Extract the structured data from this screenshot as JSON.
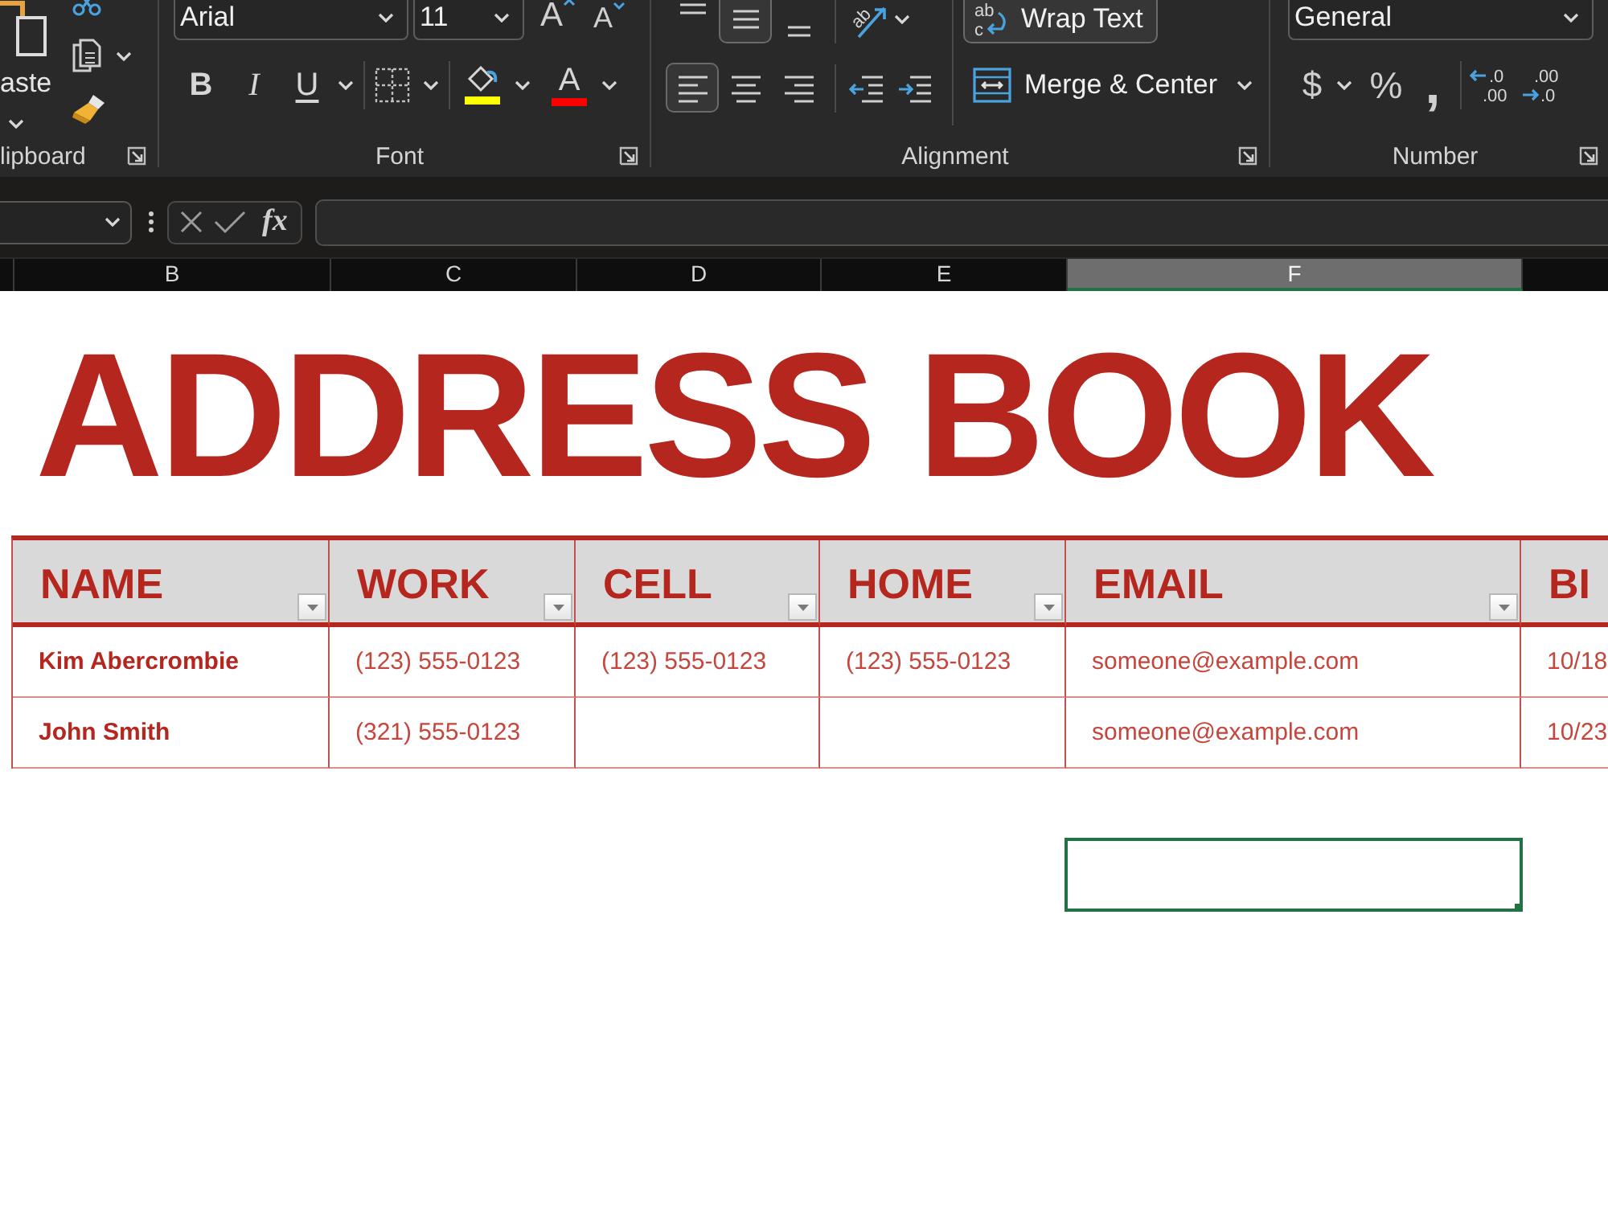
{
  "ribbon": {
    "clipboard": {
      "paste_label": "aste",
      "group_label": "lipboard"
    },
    "font": {
      "font_name": "Arial",
      "font_size": "11",
      "grow_label": "A",
      "shrink_label": "A",
      "styles": [
        {
          "kind": "bold",
          "label": "B"
        },
        {
          "kind": "italic",
          "label": "I"
        },
        {
          "kind": "underline",
          "label": "U"
        }
      ],
      "color_buttons": [
        {
          "kind": "fill",
          "color": "#ffff00"
        },
        {
          "kind": "font",
          "label": "A",
          "color": "#ff0000"
        }
      ],
      "group_label": "Font"
    },
    "alignment": {
      "vertical": [
        {
          "kind": "top",
          "selected": false
        },
        {
          "kind": "middle",
          "selected": true
        },
        {
          "kind": "bottom",
          "selected": false
        }
      ],
      "orientation_label": "ab",
      "horizontal": [
        {
          "kind": "left",
          "selected": true
        },
        {
          "kind": "center",
          "selected": false
        },
        {
          "kind": "right",
          "selected": false
        }
      ],
      "wrap_text": {
        "label": "Wrap Text",
        "icon_letters": [
          "ab",
          "c"
        ],
        "selected": true
      },
      "merge": {
        "label": "Merge & Center"
      },
      "group_label": "Alignment"
    },
    "number": {
      "format": "General",
      "symbols": [
        {
          "kind": "currency",
          "label": "$"
        },
        {
          "kind": "percent",
          "label": "%"
        },
        {
          "kind": "comma",
          "label": ","
        }
      ],
      "decimals": [
        {
          "kind": "increase",
          "lines": [
            ".0",
            ".00"
          ]
        },
        {
          "kind": "decrease",
          "lines": [
            ".00",
            ".0"
          ]
        }
      ],
      "group_label": "Number"
    }
  },
  "formula_bar": {
    "function_label": "fx"
  },
  "column_headers": [
    {
      "label": "B",
      "selected": false
    },
    {
      "label": "C",
      "selected": false
    },
    {
      "label": "D",
      "selected": false
    },
    {
      "label": "E",
      "selected": false
    },
    {
      "label": "F",
      "selected": true
    }
  ],
  "sheet": {
    "title": "ADDRESS BOOK",
    "table": {
      "columns": [
        {
          "label": "NAME",
          "filter_button": true
        },
        {
          "label": "WORK",
          "filter_button": true
        },
        {
          "label": "CELL",
          "filter_button": true
        },
        {
          "label": "HOME",
          "filter_button": true
        },
        {
          "label": "EMAIL",
          "filter_button": true
        },
        {
          "label": "BI"
        }
      ],
      "rows": [
        [
          "Kim Abercrombie",
          "(123) 555-0123",
          "(123) 555-0123",
          "(123) 555-0123",
          "someone@example.com",
          "10/18"
        ],
        [
          "John Smith",
          "(321) 555-0123",
          null,
          null,
          "someone@example.com",
          "10/23"
        ]
      ]
    }
  }
}
